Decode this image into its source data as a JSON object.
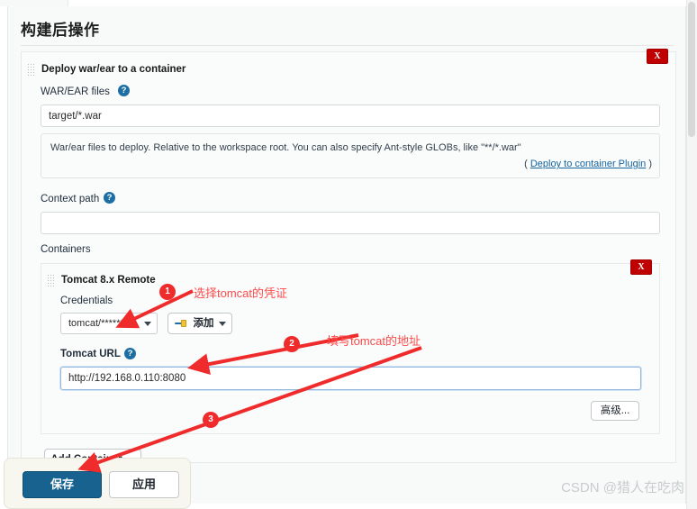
{
  "header": {
    "section_title": "构建后操作"
  },
  "deploy_block": {
    "heading": "Deploy war/ear to a container",
    "grip_icon": "drag-grip-icon",
    "delete_label": "X",
    "war_ear": {
      "label": "WAR/EAR files",
      "help_icon": "help-question-icon",
      "value": "target/*.war",
      "placeholder": ""
    },
    "description": {
      "text": "War/ear files to deploy. Relative to the workspace root. You can also specify Ant-style GLOBs, like \"**/*.war\"",
      "paren_open": "(",
      "link_text": "Deploy to container Plugin",
      "paren_close": ")"
    },
    "context_path": {
      "label": "Context path",
      "help_icon": "help-question-icon",
      "value": "",
      "placeholder": ""
    },
    "containers_label": "Containers"
  },
  "container_panel": {
    "heading": "Tomcat 8.x Remote",
    "grip_icon": "drag-grip-icon",
    "delete_label": "X",
    "credentials": {
      "label": "Credentials",
      "selected": "tomcat/******",
      "caret_icon": "chevron-down-icon",
      "add_button": "添加",
      "add_button_icon": "credential-key-icon",
      "add_caret_icon": "chevron-down-icon"
    },
    "tomcat_url": {
      "label": "Tomcat URL",
      "help_icon": "help-question-icon",
      "value": "http://192.168.0.110:8080",
      "placeholder": ""
    },
    "advanced_button": "高级..."
  },
  "add_container": {
    "label": "Add Container",
    "caret_icon": "chevron-down-icon"
  },
  "save_bar": {
    "save_label": "保存",
    "apply_label": "应用"
  },
  "annotations": [
    {
      "number": "1",
      "text": "选择tomcat的凭证"
    },
    {
      "number": "2",
      "text": "填写tomcat的地址"
    },
    {
      "number": "3",
      "text": ""
    }
  ],
  "watermark": "CSDN @猎人在吃肉",
  "colors": {
    "accent_blue": "#1c6ea4",
    "primary_button": "#17628f",
    "delete_red": "#c00000",
    "annotation_red": "#fc4c4c",
    "link_blue": "#1464a0",
    "page_bg": "#f8f9f9"
  }
}
